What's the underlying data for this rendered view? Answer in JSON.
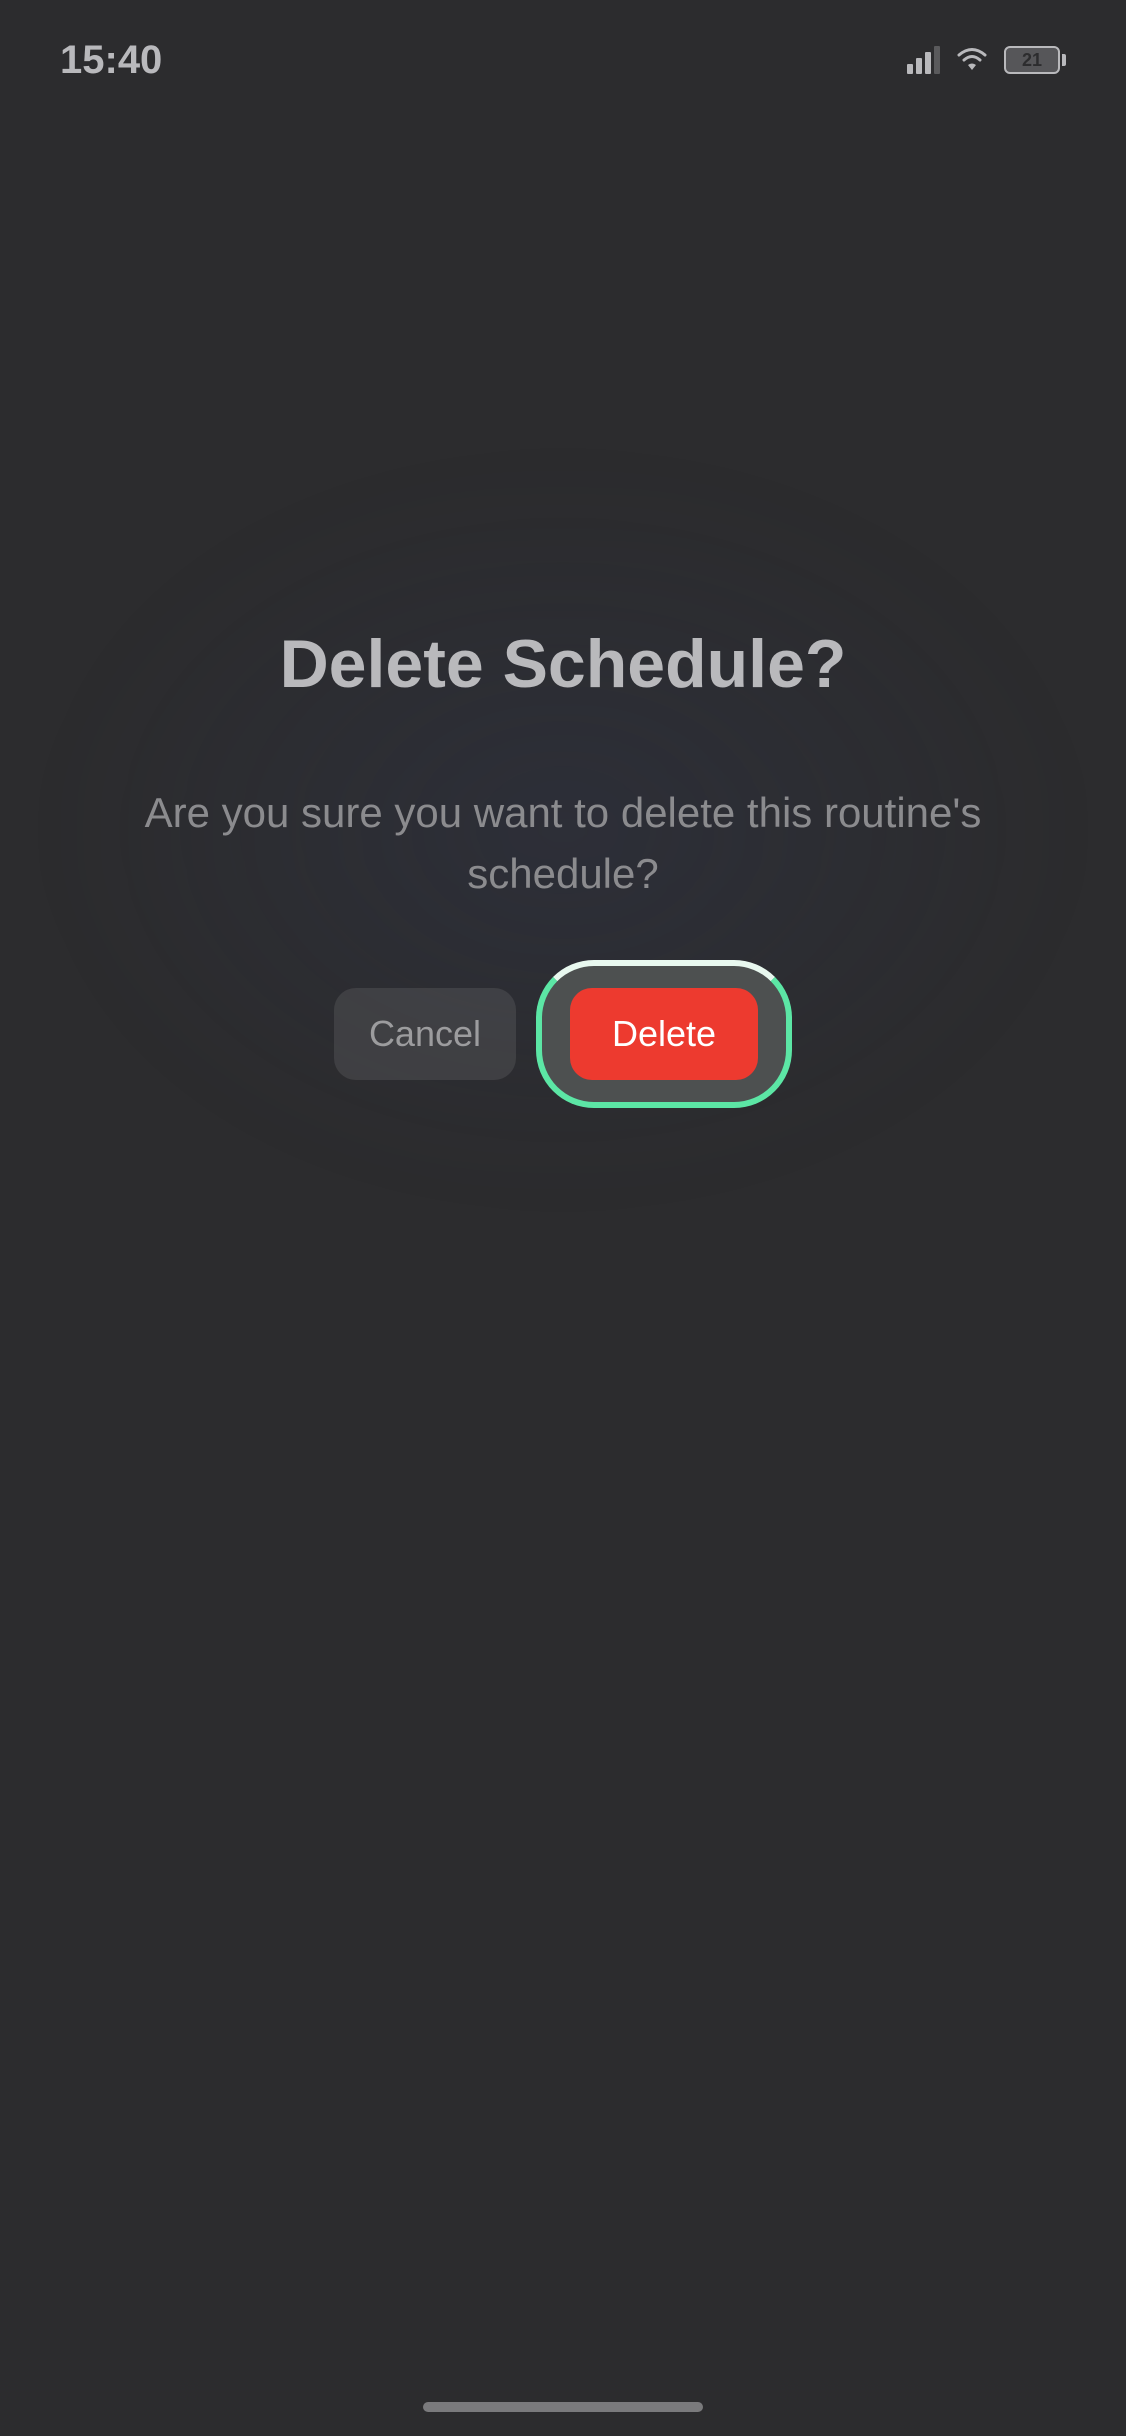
{
  "status_bar": {
    "time": "15:40",
    "battery_percent": "21"
  },
  "dialog": {
    "title": "Delete Schedule?",
    "message": "Are you sure you want to delete this routine's schedule?",
    "cancel_label": "Cancel",
    "delete_label": "Delete"
  }
}
